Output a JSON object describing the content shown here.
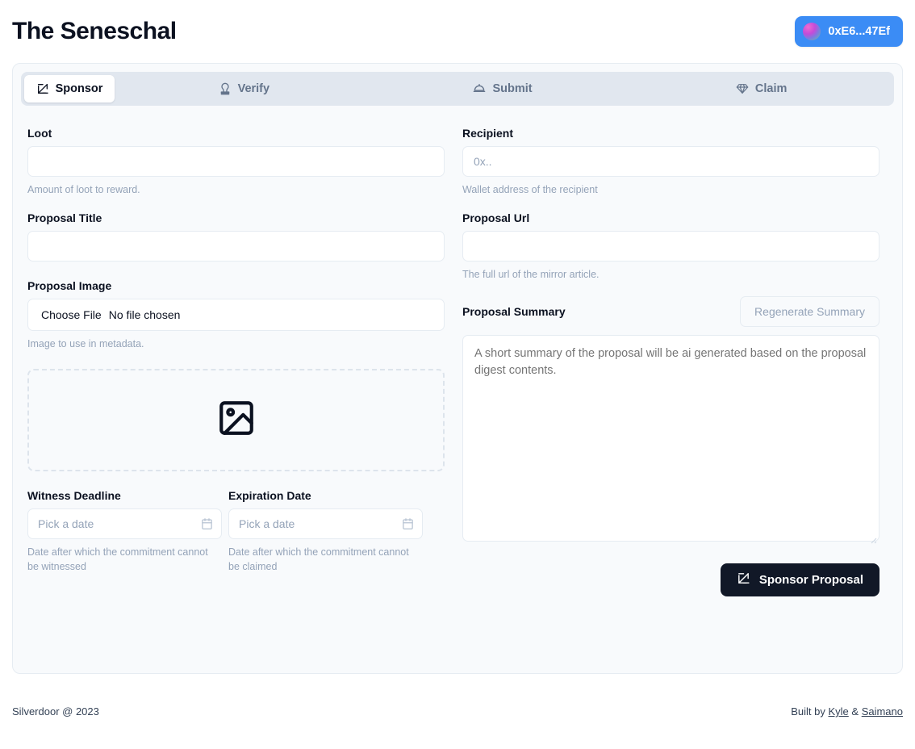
{
  "header": {
    "title": "The Seneschal",
    "wallet": {
      "address_short": "0xE6...47Ef",
      "avatar_icon": "wallet-avatar-gradient",
      "bg_color": "#3b8cf5"
    }
  },
  "tabs": [
    {
      "id": "sponsor",
      "label": "Sponsor",
      "icon": "square-pen-icon",
      "active": true
    },
    {
      "id": "verify",
      "label": "Verify",
      "icon": "stamp-icon",
      "active": false
    },
    {
      "id": "submit",
      "label": "Submit",
      "icon": "bell-dome-icon",
      "active": false
    },
    {
      "id": "claim",
      "label": "Claim",
      "icon": "gem-icon",
      "active": false
    }
  ],
  "form": {
    "loot": {
      "label": "Loot",
      "value": "",
      "placeholder": "",
      "hint": "Amount of loot to reward."
    },
    "recipient": {
      "label": "Recipient",
      "value": "",
      "placeholder": "0x..",
      "hint": "Wallet address of the recipient"
    },
    "proposal_title": {
      "label": "Proposal Title",
      "value": "",
      "placeholder": "",
      "hint": ""
    },
    "proposal_url": {
      "label": "Proposal Url",
      "value": "",
      "placeholder": "",
      "hint": "The full url of the mirror article."
    },
    "proposal_image": {
      "label": "Proposal Image",
      "choose_file_label": "Choose File",
      "file_status": "No file chosen",
      "hint": "Image to use in metadata.",
      "dropzone_icon": "image-placeholder-icon"
    },
    "witness_deadline": {
      "label": "Witness Deadline",
      "placeholder": "Pick a date",
      "value": "",
      "hint": "Date after which the commitment cannot be witnessed",
      "icon": "calendar-icon"
    },
    "expiration_date": {
      "label": "Expiration Date",
      "placeholder": "Pick a date",
      "value": "",
      "hint": "Date after which the commitment cannot be claimed",
      "icon": "calendar-icon"
    },
    "proposal_summary": {
      "label": "Proposal Summary",
      "regenerate_label": "Regenerate Summary",
      "value": "",
      "placeholder": "A short summary of the proposal will be ai generated based on the proposal digest contents."
    },
    "submit_button": {
      "label": "Sponsor Proposal",
      "icon": "square-pen-icon",
      "bg_color": "#111827"
    }
  },
  "footer": {
    "copyright": "Silverdoor @ 2023",
    "built_by_prefix": "Built by ",
    "link_one": "Kyle",
    "separator": " & ",
    "link_two": "Saimano"
  }
}
